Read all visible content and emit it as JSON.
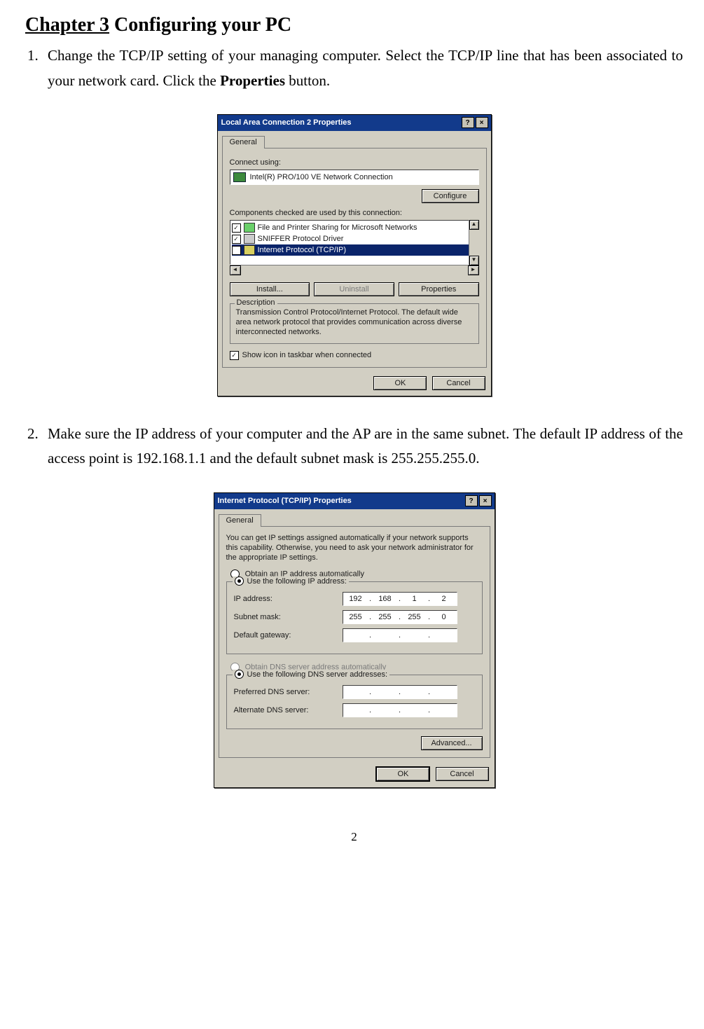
{
  "chapter": {
    "num": "Chapter 3",
    "title": " Configuring your PC"
  },
  "step1": {
    "marker": "1.",
    "text_a": "Change the TCP/IP setting of your managing computer. Select the TCP/IP line that has been associated to your network card. Click the ",
    "bold": "Properties",
    "text_b": " button."
  },
  "step2": {
    "marker": "2.",
    "text": "Make sure the IP address of your computer and the AP are in the same subnet. The default IP address of the access point is 192.168.1.1 and the default subnet mask is 255.255.255.0."
  },
  "dlg1": {
    "title": "Local Area Connection 2 Properties",
    "help": "?",
    "close": "×",
    "tab": "General",
    "connect_using_label": "Connect using:",
    "adapter": "Intel(R) PRO/100 VE Network Connection",
    "configure": "Configure",
    "components_label": "Components checked are used by this connection:",
    "items": [
      {
        "label": "File and Printer Sharing for Microsoft Networks"
      },
      {
        "label": "SNIFFER Protocol Driver"
      },
      {
        "label": "Internet Protocol (TCP/IP)"
      }
    ],
    "install": "Install...",
    "uninstall": "Uninstall",
    "properties": "Properties",
    "desc_title": "Description",
    "desc": "Transmission Control Protocol/Internet Protocol. The default wide area network protocol that provides communication across diverse interconnected networks.",
    "showicon": "Show icon in taskbar when connected",
    "ok": "OK",
    "cancel": "Cancel"
  },
  "dlg2": {
    "title": "Internet Protocol (TCP/IP) Properties",
    "help": "?",
    "close": "×",
    "tab": "General",
    "note": "You can get IP settings assigned automatically if your network supports this capability. Otherwise, you need to ask your network administrator for the appropriate IP settings.",
    "opt_auto": "Obtain an IP address automatically",
    "opt_manual": "Use the following IP address:",
    "ip_label": "IP address:",
    "ip": [
      "192",
      "168",
      "1",
      "2"
    ],
    "mask_label": "Subnet mask:",
    "mask": [
      "255",
      "255",
      "255",
      "0"
    ],
    "gw_label": "Default gateway:",
    "gw": [
      "",
      "",
      "",
      ""
    ],
    "dns_auto": "Obtain DNS server address automatically",
    "dns_manual": "Use the following DNS server addresses:",
    "pdns_label": "Preferred DNS server:",
    "adns_label": "Alternate DNS server:",
    "advanced": "Advanced...",
    "ok": "OK",
    "cancel": "Cancel"
  },
  "page_number": "2"
}
